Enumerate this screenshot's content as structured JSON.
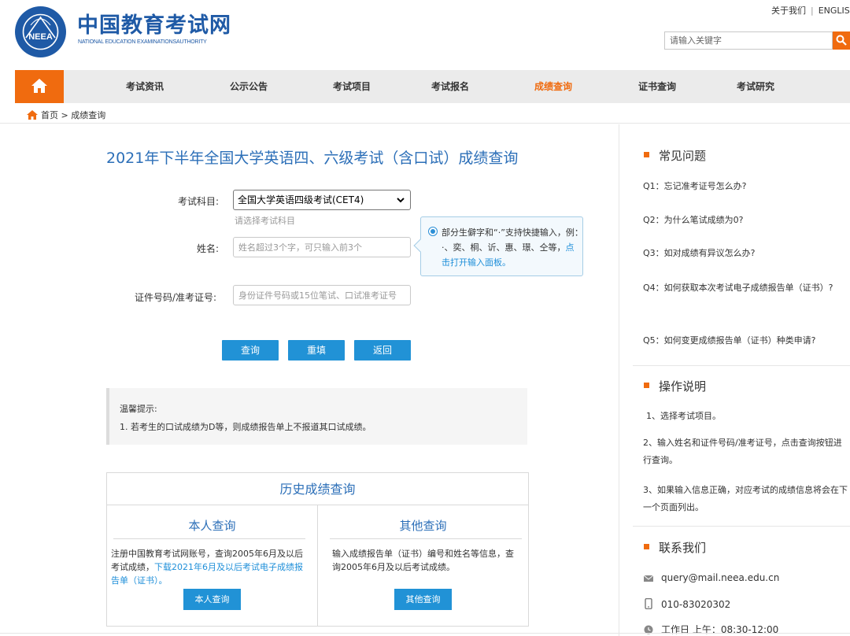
{
  "header": {
    "logo_cn": "中国教育考试网",
    "logo_en": "NATIONAL EDUCATION EXAMINATIONSAUTHORITY",
    "logo_seal_text": "NEEA",
    "top_links": [
      "关于我们",
      "ENGLIS"
    ],
    "search_placeholder": "请输入关键字"
  },
  "nav": {
    "items": [
      "考试资讯",
      "公示公告",
      "考试项目",
      "考试报名",
      "成绩查询",
      "证书查询",
      "考试研究"
    ],
    "active": "成绩查询"
  },
  "breadcrumb": {
    "home": "首页",
    "sep": ">",
    "current": "成绩查询"
  },
  "main": {
    "title": "2021年下半年全国大学英语四、六级考试（含口试）成绩查询",
    "subject_label": "考试科目:",
    "subject_value": "全国大学英语四级考试(CET4)",
    "subject_hint": "请选择考试科目",
    "name_label": "姓名:",
    "name_placeholder": "姓名超过3个字，可只输入前3个",
    "id_label": "证件号码/准考证号:",
    "id_placeholder": "身份证件号码或15位笔试、口试准考证号",
    "tip_text": "部分生僻字和“·”支持快捷输入，例：·、奕、桐、䜣、惠、璟、仝等，",
    "tip_link": "点击打开输入面板。",
    "buttons": {
      "query": "查询",
      "reset": "重填",
      "back": "返回"
    },
    "notice_title": "温馨提示:",
    "notice_text": "1. 若考生的口试成绩为D等，则成绩报告单上不报道其口试成绩。"
  },
  "history": {
    "title": "历史成绩查询",
    "self": {
      "title": "本人查询",
      "text": "注册中国教育考试网账号，查询2005年6月及以后考试成绩，",
      "link": "下载2021年6月及以后考试电子成绩报告单（证书）。",
      "button": "本人查询"
    },
    "other": {
      "title": "其他查询",
      "text": "输入成绩报告单（证书）编号和姓名等信息，查询2005年6月及以后考试成绩。",
      "button": "其他查询"
    }
  },
  "sidebar": {
    "faq_title": "常见问题",
    "faq": [
      "Q1：忘记准考证号怎么办?",
      "Q2：为什么笔试成绩为0?",
      "Q3：如对成绩有异议怎么办?",
      "Q4：如何获取本次考试电子成绩报告单（证书）?",
      "Q5：如何变更成绩报告单（证书）种类申请?"
    ],
    "ops_title": "操作说明",
    "ops": [
      "1、选择考试项目。",
      "2、输入姓名和证件号码/准考证号，点击查询按钮进行查询。",
      "3、如果输入信息正确，对应考试的成绩信息将会在下一个页面列出。"
    ],
    "contact_title": "联系我们",
    "contact": {
      "email": "query@mail.neea.edu.cn",
      "phone": "010-83020302",
      "hours": "工作日 上午：08:30-12:00"
    }
  },
  "colors": {
    "brand_blue": "#1f5aa6",
    "accent_orange": "#f06b0f",
    "button_blue": "#2192d6"
  }
}
